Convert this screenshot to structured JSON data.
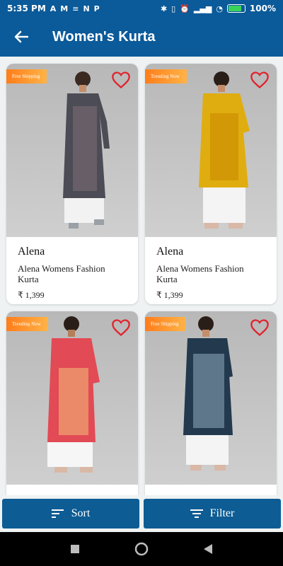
{
  "status_bar": {
    "time": "5:35 PM",
    "app_icons": [
      "A",
      "M",
      "≡",
      "N",
      "P"
    ],
    "battery": "100%"
  },
  "app_bar": {
    "title": "Women's Kurta",
    "back_icon": "arrow-left-icon"
  },
  "products": [
    {
      "badge": "Free Shipping",
      "brand": "Alena",
      "name": "Alena Womens Fashion Kurta",
      "price": "₹ 1,399",
      "kurta_color": "#4b4c55",
      "accent": "#b36a6a"
    },
    {
      "badge": "Trending Now",
      "brand": "Alena",
      "name": "Alena Womens Fashion Kurta",
      "price": "₹ 1,399",
      "kurta_color": "#e0ad10",
      "accent": "#c98a00"
    },
    {
      "badge": "Trending Now",
      "brand": "",
      "name": "",
      "price": "",
      "kurta_color": "#e24a55",
      "accent": "#f2c07a"
    },
    {
      "badge": "Free Shipping",
      "brand": "",
      "name": "",
      "price": "",
      "kurta_color": "#22394e",
      "accent": "#a9c4d6"
    }
  ],
  "bottom_buttons": {
    "sort_label": "Sort",
    "filter_label": "Filter"
  },
  "colors": {
    "primary": "#0b5a99",
    "badge_orange": "#ff7d1a",
    "heart": "#e0242e"
  }
}
